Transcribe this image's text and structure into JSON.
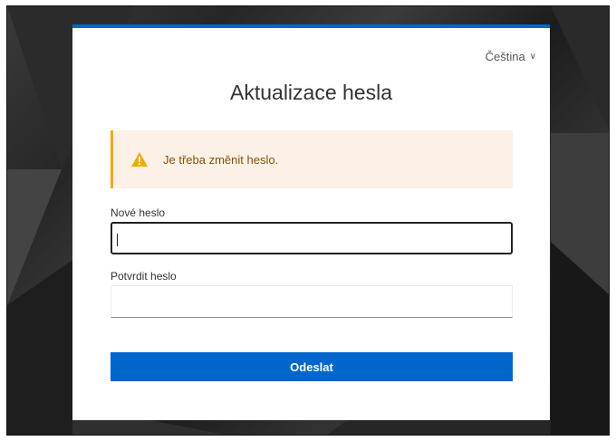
{
  "language": {
    "selected": "Čeština",
    "chevron": "chevron-down-icon"
  },
  "page": {
    "title": "Aktualizace hesla"
  },
  "alert": {
    "icon": "warning-icon",
    "message": "Je třeba změnit heslo."
  },
  "form": {
    "new_password": {
      "label": "Nové heslo",
      "value": ""
    },
    "confirm_password": {
      "label": "Potvrdit heslo",
      "value": ""
    },
    "submit_label": "Odeslat"
  },
  "colors": {
    "accent": "#0066cc",
    "warning": "#f0ab00",
    "alert_bg": "#fdf0e7"
  }
}
